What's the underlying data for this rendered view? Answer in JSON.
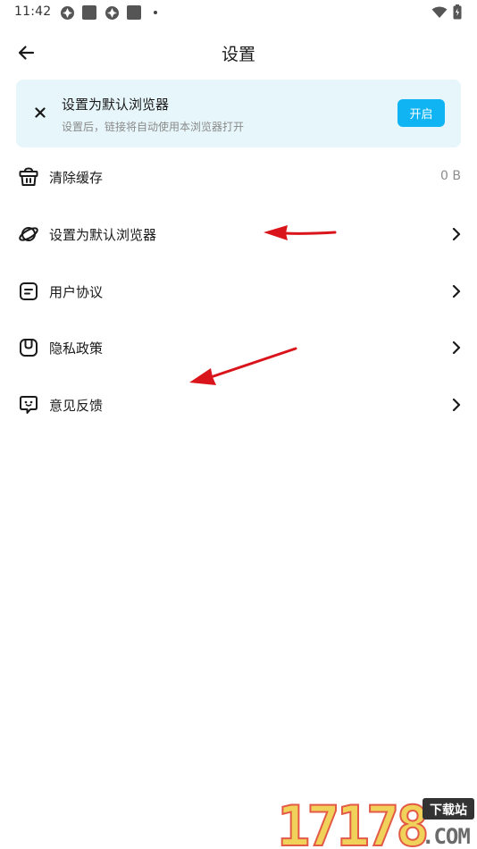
{
  "status_bar": {
    "time": "11:42"
  },
  "header": {
    "title": "设置"
  },
  "banner": {
    "title": "设置为默认浏览器",
    "subtitle": "设置后，链接将自动使用本浏览器打开",
    "action_label": "开启"
  },
  "settings": [
    {
      "label": "清除缓存",
      "value": "0 B",
      "icon": "basket-icon"
    },
    {
      "label": "设置为默认浏览器",
      "icon": "planet-icon"
    },
    {
      "label": "用户协议",
      "icon": "document-icon"
    },
    {
      "label": "隐私政策",
      "icon": "privacy-icon"
    },
    {
      "label": "意见反馈",
      "icon": "feedback-icon"
    }
  ],
  "watermark": {
    "number": "17178",
    "badge": "下载站",
    "domain": ".COM"
  },
  "colors": {
    "accent": "#10b4f2",
    "banner_bg": "#e7f6fb",
    "annotation_arrow": "#d9141b"
  }
}
